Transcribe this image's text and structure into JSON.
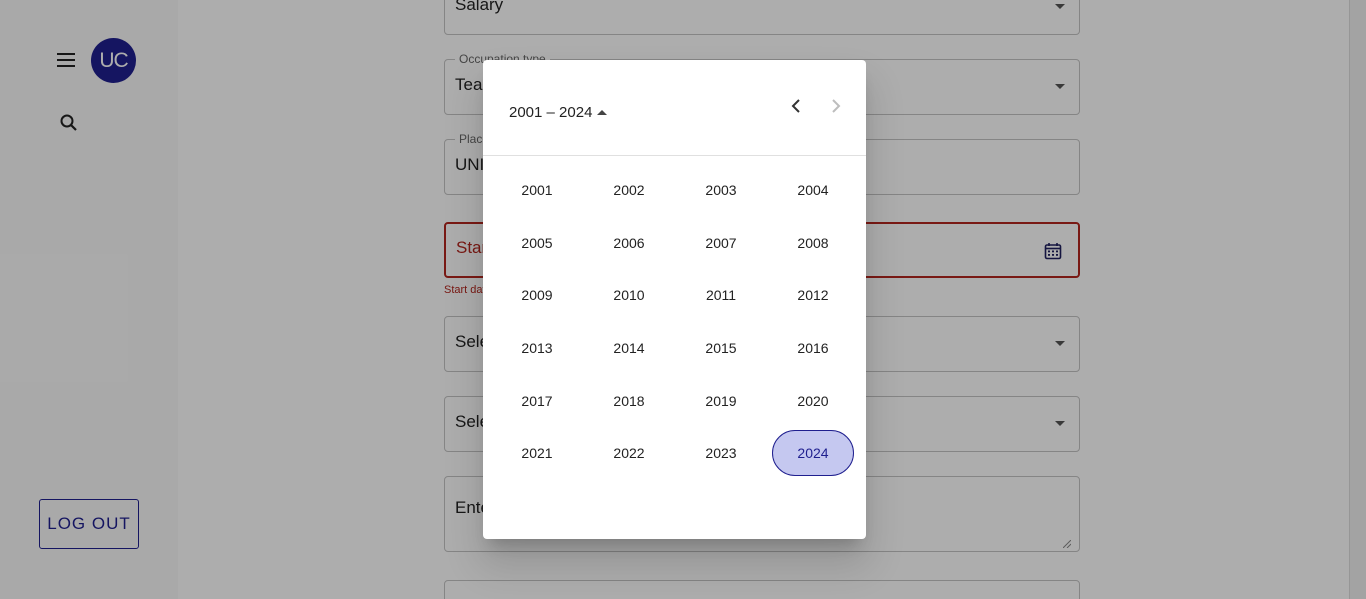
{
  "sidebar": {
    "avatar_text": "UC",
    "logout_label": "LOG OUT",
    "icons": [
      "menu-icon",
      "search-icon"
    ]
  },
  "form": {
    "salary_value": "Salary",
    "occupation_label": "Occupation type",
    "occupation_value": "Teacher",
    "place_label": "Place",
    "place_value": "UNI",
    "start_date_placeholder": "Start date",
    "start_date_helper": "Start date is required",
    "select_1_placeholder": "Select",
    "select_2_placeholder": "Select",
    "textarea_placeholder": "Enter"
  },
  "datepicker": {
    "period_label": "2001 – 2024",
    "years": [
      [
        "2001",
        "2002",
        "2003",
        "2004"
      ],
      [
        "2005",
        "2006",
        "2007",
        "2008"
      ],
      [
        "2009",
        "2010",
        "2011",
        "2012"
      ],
      [
        "2013",
        "2014",
        "2015",
        "2016"
      ],
      [
        "2017",
        "2018",
        "2019",
        "2020"
      ],
      [
        "2021",
        "2022",
        "2023",
        "2024"
      ]
    ],
    "selected_year": "2024"
  },
  "colors": {
    "brand": "#1f1f8f",
    "error": "#b3261e",
    "selected_year_bg": "#c5c8f0"
  }
}
